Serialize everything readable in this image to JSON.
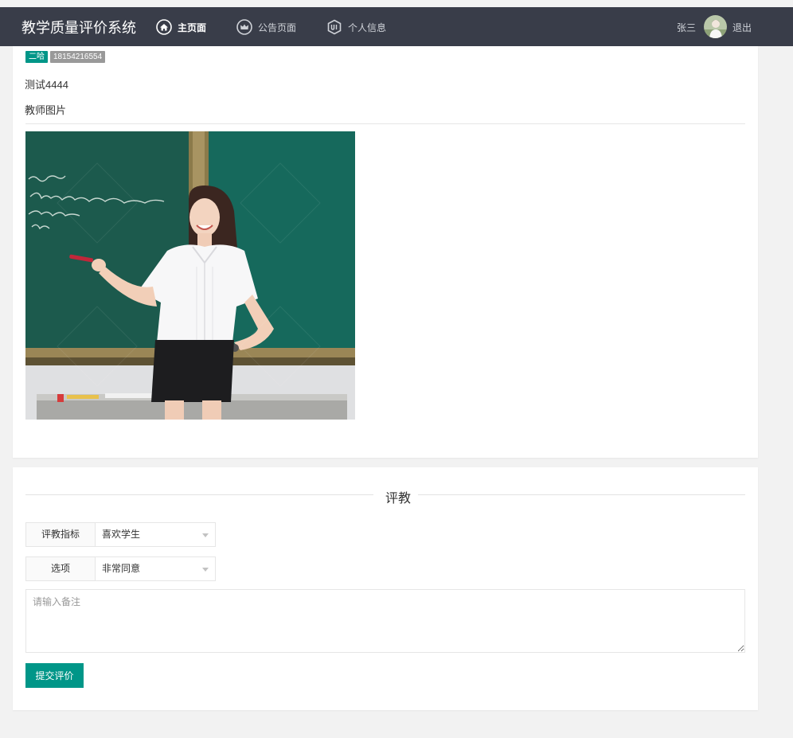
{
  "header": {
    "title": "教学质量评价系统",
    "nav": [
      {
        "label": "主页面",
        "icon": "home-icon",
        "active": true
      },
      {
        "label": "公告页面",
        "icon": "crown-icon",
        "active": false
      },
      {
        "label": "个人信息",
        "icon": "ui-badge-icon",
        "active": false
      }
    ],
    "user_name": "张三",
    "logout_label": "退出"
  },
  "teacher": {
    "badge_name": "二哈",
    "badge_phone": "18154216554",
    "description": "测试4444",
    "photo_label": "教师图片",
    "photo_icon": "teacher-photo"
  },
  "evaluation": {
    "section_title": "评教",
    "indicator_label": "评教指标",
    "indicator_value": "喜欢学生",
    "option_label": "选项",
    "option_value": "非常同意",
    "remark_placeholder": "请输入备注",
    "submit_label": "提交评价"
  },
  "colors": {
    "header_bg": "#393d49",
    "accent": "#009688",
    "badge_gray": "#999999",
    "page_bg": "#f2f2f2"
  }
}
